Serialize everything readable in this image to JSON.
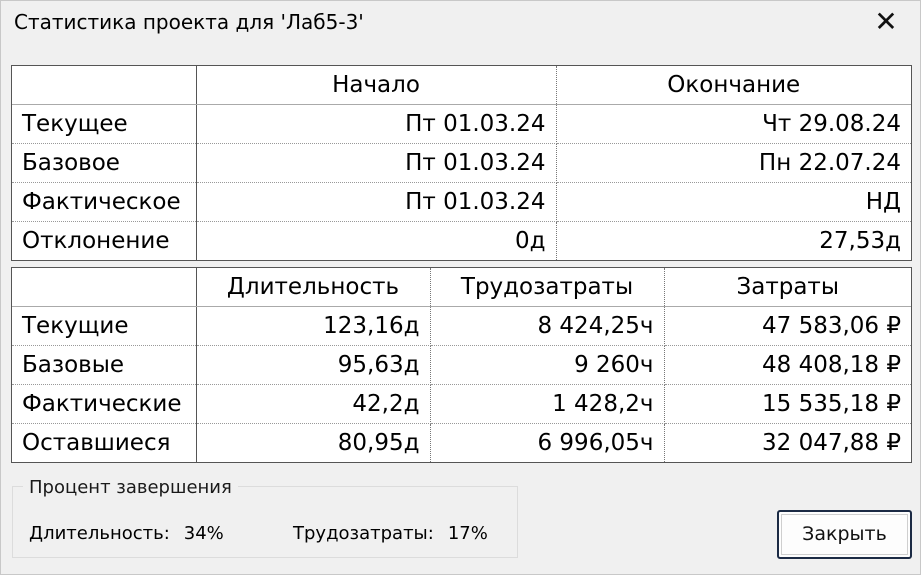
{
  "window": {
    "title": "Статистика проекта для 'Лаб5-3'",
    "close_glyph": "✕"
  },
  "dates_table": {
    "headers": [
      "",
      "Начало",
      "Окончание"
    ],
    "rows": [
      {
        "label": "Текущее",
        "start": "Пт 01.03.24",
        "finish": "Чт 29.08.24"
      },
      {
        "label": "Базовое",
        "start": "Пт 01.03.24",
        "finish": "Пн 22.07.24"
      },
      {
        "label": "Фактическое",
        "start": "Пт 01.03.24",
        "finish": "НД"
      },
      {
        "label": "Отклонение",
        "start": "0д",
        "finish": "27,53д"
      }
    ]
  },
  "totals_table": {
    "headers": [
      "",
      "Длительность",
      "Трудозатраты",
      "Затраты"
    ],
    "rows": [
      {
        "label": "Текущие",
        "duration": "123,16д",
        "work": "8 424,25ч",
        "cost": "47 583,06 ₽"
      },
      {
        "label": "Базовые",
        "duration": "95,63д",
        "work": "9 260ч",
        "cost": "48 408,18 ₽"
      },
      {
        "label": "Фактические",
        "duration": "42,2д",
        "work": "1 428,2ч",
        "cost": "15 535,18 ₽"
      },
      {
        "label": "Оставшиеся",
        "duration": "80,95д",
        "work": "6 996,05ч",
        "cost": "32 047,88 ₽"
      }
    ]
  },
  "completion": {
    "group_title": "Процент завершения",
    "duration_label": "Длительность:",
    "duration_value": "34%",
    "work_label": "Трудозатраты:",
    "work_value": "17%"
  },
  "buttons": {
    "close_label": "Закрыть"
  }
}
